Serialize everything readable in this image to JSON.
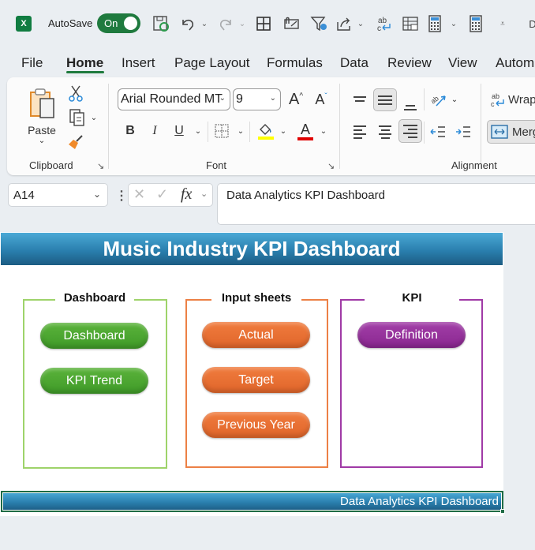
{
  "titlebar": {
    "app_icon": "excel-icon",
    "autosave_label": "AutoSave",
    "autosave_state": "On",
    "icons": [
      "save-sync-icon",
      "undo-icon",
      "redo-icon",
      "borders-icon",
      "attach-icon",
      "filter-settings-icon",
      "share-icon",
      "spelling-icon",
      "table-icon",
      "calculator-icon",
      "calculator-icon",
      "customize-qat-icon"
    ]
  },
  "tabs": [
    {
      "label": "File",
      "active": false
    },
    {
      "label": "Home",
      "active": true
    },
    {
      "label": "Insert",
      "active": false
    },
    {
      "label": "Page Layout",
      "active": false
    },
    {
      "label": "Formulas",
      "active": false
    },
    {
      "label": "Data",
      "active": false
    },
    {
      "label": "Review",
      "active": false
    },
    {
      "label": "View",
      "active": false
    },
    {
      "label": "Autom",
      "active": false
    }
  ],
  "ribbon": {
    "clipboard": {
      "label": "Clipboard",
      "paste_label": "Paste"
    },
    "font": {
      "label": "Font",
      "font_name": "Arial Rounded MT",
      "font_size": "9",
      "bold": "B",
      "italic": "I",
      "underline": "U",
      "font_color_letter": "A",
      "fill_color": "#ffff00",
      "font_color": "#e00000"
    },
    "alignment": {
      "label": "Alignment",
      "wrap_label": "Wrap",
      "merge_label": "Merg"
    }
  },
  "formula_bar": {
    "name_box": "A14",
    "fx_label": "fx",
    "formula": "Data Analytics KPI Dashboard"
  },
  "sheet": {
    "title": "Music Industry KPI Dashboard",
    "footer": "Data Analytics KPI Dashboard",
    "groups": [
      {
        "title": "Dashboard",
        "color": "#9ed36a",
        "buttons": [
          "Dashboard",
          "KPI Trend"
        ]
      },
      {
        "title": "Input sheets",
        "color": "#ec8045",
        "buttons": [
          "Actual",
          "Target",
          "Previous Year"
        ]
      },
      {
        "title": "KPI",
        "color": "#a03aa6",
        "buttons": [
          "Definition"
        ]
      }
    ]
  }
}
